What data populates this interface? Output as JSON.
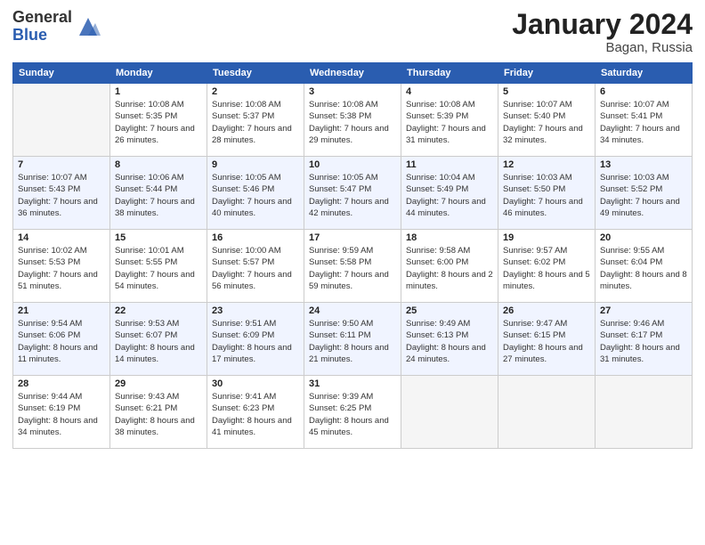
{
  "header": {
    "logo_general": "General",
    "logo_blue": "Blue",
    "month_title": "January 2024",
    "location": "Bagan, Russia"
  },
  "days_of_week": [
    "Sunday",
    "Monday",
    "Tuesday",
    "Wednesday",
    "Thursday",
    "Friday",
    "Saturday"
  ],
  "weeks": [
    [
      {
        "day": "",
        "empty": true
      },
      {
        "day": "1",
        "sunrise": "10:08 AM",
        "sunset": "5:35 PM",
        "daylight": "7 hours and 26 minutes."
      },
      {
        "day": "2",
        "sunrise": "10:08 AM",
        "sunset": "5:37 PM",
        "daylight": "7 hours and 28 minutes."
      },
      {
        "day": "3",
        "sunrise": "10:08 AM",
        "sunset": "5:38 PM",
        "daylight": "7 hours and 29 minutes."
      },
      {
        "day": "4",
        "sunrise": "10:08 AM",
        "sunset": "5:39 PM",
        "daylight": "7 hours and 31 minutes."
      },
      {
        "day": "5",
        "sunrise": "10:07 AM",
        "sunset": "5:40 PM",
        "daylight": "7 hours and 32 minutes."
      },
      {
        "day": "6",
        "sunrise": "10:07 AM",
        "sunset": "5:41 PM",
        "daylight": "7 hours and 34 minutes."
      }
    ],
    [
      {
        "day": "7",
        "sunrise": "10:07 AM",
        "sunset": "5:43 PM",
        "daylight": "7 hours and 36 minutes."
      },
      {
        "day": "8",
        "sunrise": "10:06 AM",
        "sunset": "5:44 PM",
        "daylight": "7 hours and 38 minutes."
      },
      {
        "day": "9",
        "sunrise": "10:05 AM",
        "sunset": "5:46 PM",
        "daylight": "7 hours and 40 minutes."
      },
      {
        "day": "10",
        "sunrise": "10:05 AM",
        "sunset": "5:47 PM",
        "daylight": "7 hours and 42 minutes."
      },
      {
        "day": "11",
        "sunrise": "10:04 AM",
        "sunset": "5:49 PM",
        "daylight": "7 hours and 44 minutes."
      },
      {
        "day": "12",
        "sunrise": "10:03 AM",
        "sunset": "5:50 PM",
        "daylight": "7 hours and 46 minutes."
      },
      {
        "day": "13",
        "sunrise": "10:03 AM",
        "sunset": "5:52 PM",
        "daylight": "7 hours and 49 minutes."
      }
    ],
    [
      {
        "day": "14",
        "sunrise": "10:02 AM",
        "sunset": "5:53 PM",
        "daylight": "7 hours and 51 minutes."
      },
      {
        "day": "15",
        "sunrise": "10:01 AM",
        "sunset": "5:55 PM",
        "daylight": "7 hours and 54 minutes."
      },
      {
        "day": "16",
        "sunrise": "10:00 AM",
        "sunset": "5:57 PM",
        "daylight": "7 hours and 56 minutes."
      },
      {
        "day": "17",
        "sunrise": "9:59 AM",
        "sunset": "5:58 PM",
        "daylight": "7 hours and 59 minutes."
      },
      {
        "day": "18",
        "sunrise": "9:58 AM",
        "sunset": "6:00 PM",
        "daylight": "8 hours and 2 minutes."
      },
      {
        "day": "19",
        "sunrise": "9:57 AM",
        "sunset": "6:02 PM",
        "daylight": "8 hours and 5 minutes."
      },
      {
        "day": "20",
        "sunrise": "9:55 AM",
        "sunset": "6:04 PM",
        "daylight": "8 hours and 8 minutes."
      }
    ],
    [
      {
        "day": "21",
        "sunrise": "9:54 AM",
        "sunset": "6:06 PM",
        "daylight": "8 hours and 11 minutes."
      },
      {
        "day": "22",
        "sunrise": "9:53 AM",
        "sunset": "6:07 PM",
        "daylight": "8 hours and 14 minutes."
      },
      {
        "day": "23",
        "sunrise": "9:51 AM",
        "sunset": "6:09 PM",
        "daylight": "8 hours and 17 minutes."
      },
      {
        "day": "24",
        "sunrise": "9:50 AM",
        "sunset": "6:11 PM",
        "daylight": "8 hours and 21 minutes."
      },
      {
        "day": "25",
        "sunrise": "9:49 AM",
        "sunset": "6:13 PM",
        "daylight": "8 hours and 24 minutes."
      },
      {
        "day": "26",
        "sunrise": "9:47 AM",
        "sunset": "6:15 PM",
        "daylight": "8 hours and 27 minutes."
      },
      {
        "day": "27",
        "sunrise": "9:46 AM",
        "sunset": "6:17 PM",
        "daylight": "8 hours and 31 minutes."
      }
    ],
    [
      {
        "day": "28",
        "sunrise": "9:44 AM",
        "sunset": "6:19 PM",
        "daylight": "8 hours and 34 minutes."
      },
      {
        "day": "29",
        "sunrise": "9:43 AM",
        "sunset": "6:21 PM",
        "daylight": "8 hours and 38 minutes."
      },
      {
        "day": "30",
        "sunrise": "9:41 AM",
        "sunset": "6:23 PM",
        "daylight": "8 hours and 41 minutes."
      },
      {
        "day": "31",
        "sunrise": "9:39 AM",
        "sunset": "6:25 PM",
        "daylight": "8 hours and 45 minutes."
      },
      {
        "day": "",
        "empty": true
      },
      {
        "day": "",
        "empty": true
      },
      {
        "day": "",
        "empty": true
      }
    ]
  ],
  "labels": {
    "sunrise": "Sunrise:",
    "sunset": "Sunset:",
    "daylight": "Daylight:"
  }
}
